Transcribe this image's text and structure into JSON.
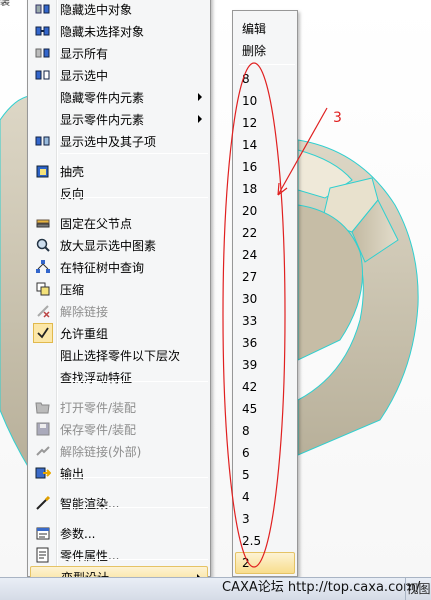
{
  "top_stub": "装",
  "menu": {
    "items": [
      {
        "label": "隐藏选中对象",
        "icon": "hide-selected-icon",
        "disabled": false,
        "submenu": false
      },
      {
        "label": "隐藏未选择对象",
        "icon": "hide-unselected-icon",
        "disabled": false,
        "submenu": false
      },
      {
        "label": "显示所有",
        "icon": "show-all-icon",
        "disabled": false,
        "submenu": false
      },
      {
        "label": "显示选中",
        "icon": "show-selected-icon",
        "disabled": false,
        "submenu": false
      },
      {
        "label": "隐藏零件内元素",
        "icon": "",
        "disabled": false,
        "submenu": true
      },
      {
        "label": "显示零件内元素",
        "icon": "",
        "disabled": false,
        "submenu": true
      },
      {
        "label": "显示选中及其子项",
        "icon": "show-selected-children-icon",
        "disabled": false,
        "submenu": false
      },
      {
        "label": "抽壳",
        "icon": "shell-icon",
        "disabled": false,
        "submenu": false
      },
      {
        "label": "反向",
        "icon": "",
        "disabled": false,
        "submenu": false
      },
      {
        "label": "固定在父节点",
        "icon": "pin-to-parent-icon",
        "disabled": false,
        "submenu": false
      },
      {
        "label": "放大显示选中图素",
        "icon": "zoom-selected-icon",
        "disabled": false,
        "submenu": false
      },
      {
        "label": "在特征树中查询",
        "icon": "tree-query-icon",
        "disabled": false,
        "submenu": false
      },
      {
        "label": "压缩",
        "icon": "suppress-icon",
        "disabled": false,
        "submenu": false
      },
      {
        "label": "解除链接",
        "icon": "unlink-icon",
        "disabled": true,
        "submenu": false
      },
      {
        "label": "允许重组",
        "icon": "check-icon",
        "disabled": false,
        "submenu": false
      },
      {
        "label": "阻止选择零件以下层次",
        "icon": "",
        "disabled": false,
        "submenu": false
      },
      {
        "label": "查找浮动特征",
        "icon": "",
        "disabled": false,
        "submenu": false
      },
      {
        "label": "打开零件/装配",
        "icon": "open-part-icon",
        "disabled": true,
        "submenu": false
      },
      {
        "label": "保存零件/装配",
        "icon": "save-part-icon",
        "disabled": true,
        "submenu": false
      },
      {
        "label": "解除链接(外部)",
        "icon": "unlink-external-icon",
        "disabled": true,
        "submenu": false
      },
      {
        "label": "输出",
        "icon": "export-icon",
        "disabled": false,
        "submenu": false
      },
      {
        "label": "智能渲染...",
        "icon": "smart-render-icon",
        "disabled": false,
        "submenu": false
      },
      {
        "label": "参数...",
        "icon": "parameters-icon",
        "disabled": false,
        "submenu": false
      },
      {
        "label": "零件属性...",
        "icon": "part-properties-icon",
        "disabled": false,
        "submenu": false
      },
      {
        "label": "变型设计",
        "icon": "",
        "disabled": false,
        "submenu": true,
        "highlight": true
      }
    ]
  },
  "submenu": {
    "edit_label": "编辑",
    "delete_label": "删除",
    "values": [
      "8",
      "10",
      "12",
      "14",
      "16",
      "18",
      "20",
      "22",
      "24",
      "27",
      "30",
      "33",
      "36",
      "39",
      "42",
      "45",
      "8",
      "6",
      "5",
      "4",
      "3",
      "2.5",
      "2"
    ]
  },
  "annotation": {
    "number": "3",
    "color": "#e02020"
  },
  "statusbar": {
    "watermark": "CAXA论坛 http://top.caxa.com/",
    "view_label": "视图"
  },
  "colors": {
    "model_face": "#cfc7b0",
    "model_edge": "#2fd0d0",
    "menu_bg": "#f5f6f7",
    "highlight": "#f8dd8d"
  }
}
